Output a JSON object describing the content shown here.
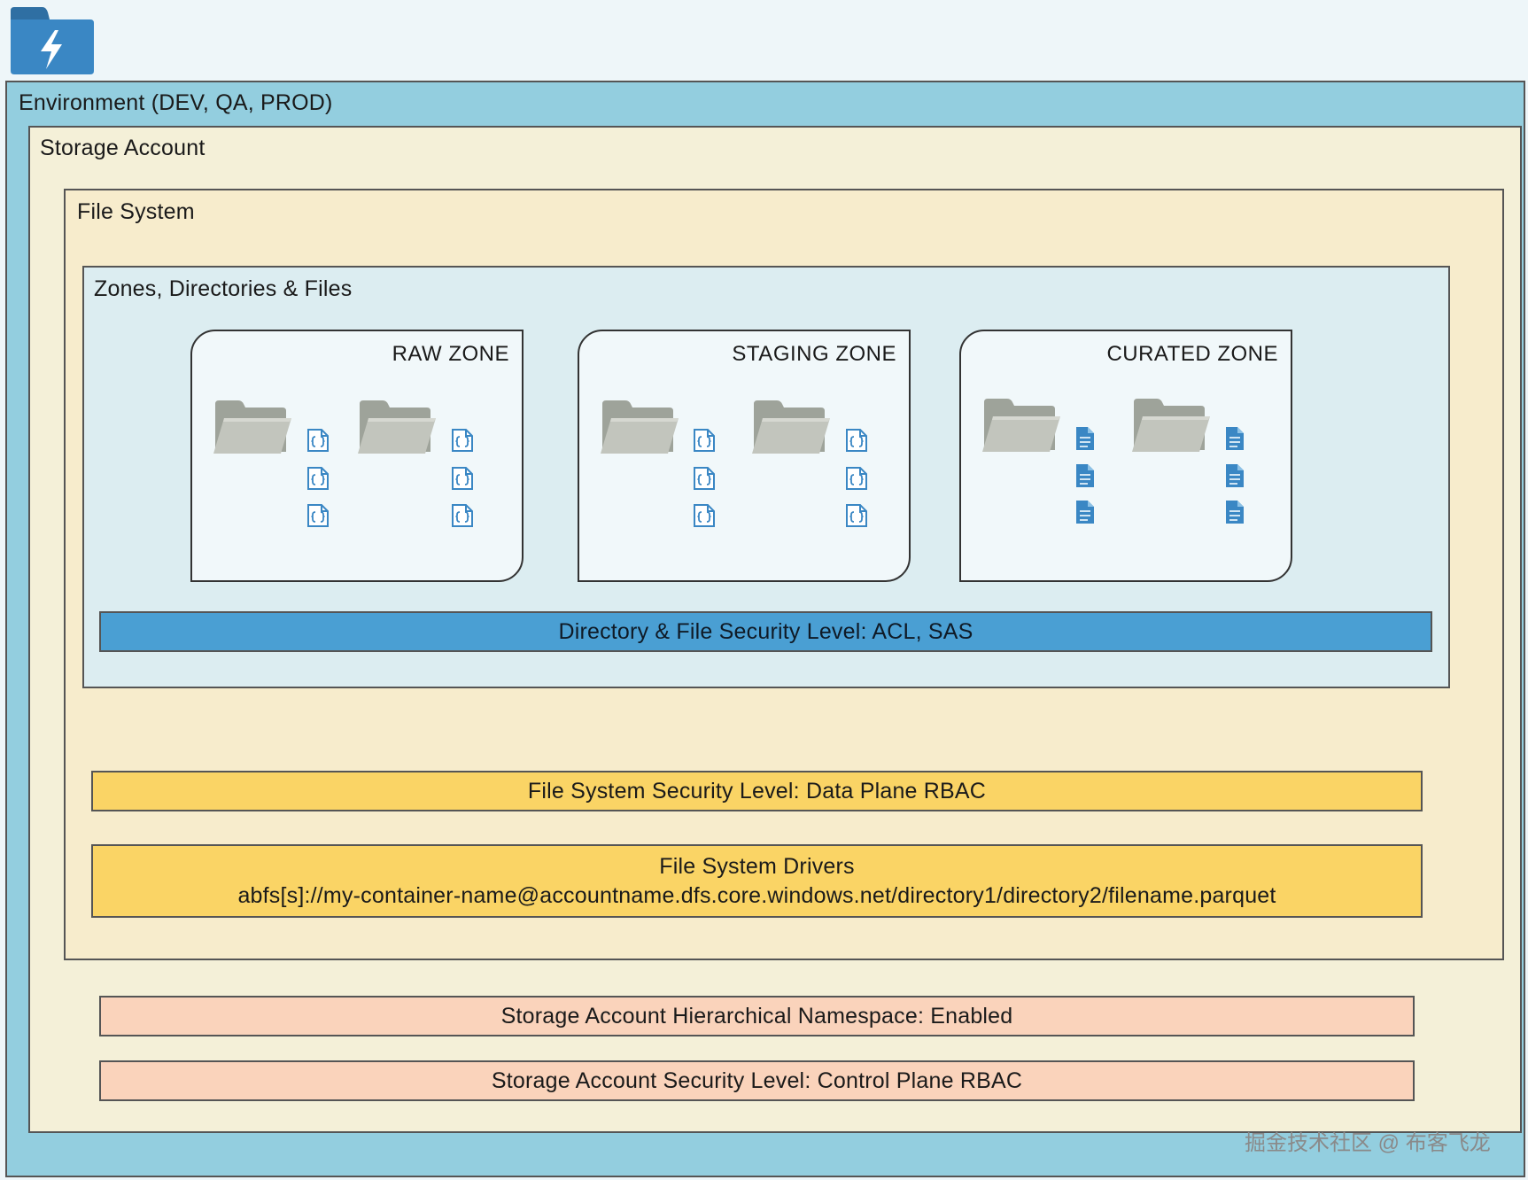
{
  "logo": {
    "icon": "lightning-folder-icon",
    "color": "#3a87c4"
  },
  "environment": {
    "title": "Environment (DEV, QA, PROD)"
  },
  "storage_account": {
    "title": "Storage Account",
    "namespace_bar": "Storage Account Hierarchical Namespace: Enabled",
    "security_bar": "Storage Account Security Level: Control Plane RBAC"
  },
  "file_system": {
    "title": "File System",
    "security_bar": "File System Security Level: Data Plane RBAC",
    "drivers_title": "File System Drivers",
    "drivers_path": "abfs[s]://my-container-name@accountname.dfs.core.windows.net/directory1/directory2/filename.parquet"
  },
  "zones": {
    "title": "Zones, Directories & Files",
    "items": [
      {
        "label": "RAW ZONE",
        "file_icon": "json-file-icon"
      },
      {
        "label": "STAGING ZONE",
        "file_icon": "json-file-icon"
      },
      {
        "label": "CURATED ZONE",
        "file_icon": "document-file-icon"
      }
    ],
    "security_bar": "Directory & File Security Level: ACL, SAS"
  },
  "watermark": "掘金技术社区 @ 布客飞龙",
  "colors": {
    "environment": "#93cedf",
    "storage_account": "#f4f0d8",
    "file_system": "#f7eccc",
    "zones": "#dcedf1",
    "acl_bar": "#4a9fd3",
    "rbac_bar": "#fad465",
    "account_bar": "#fad3bb",
    "folder": "#b9bcb4",
    "file_icon": "#3a87c4"
  }
}
